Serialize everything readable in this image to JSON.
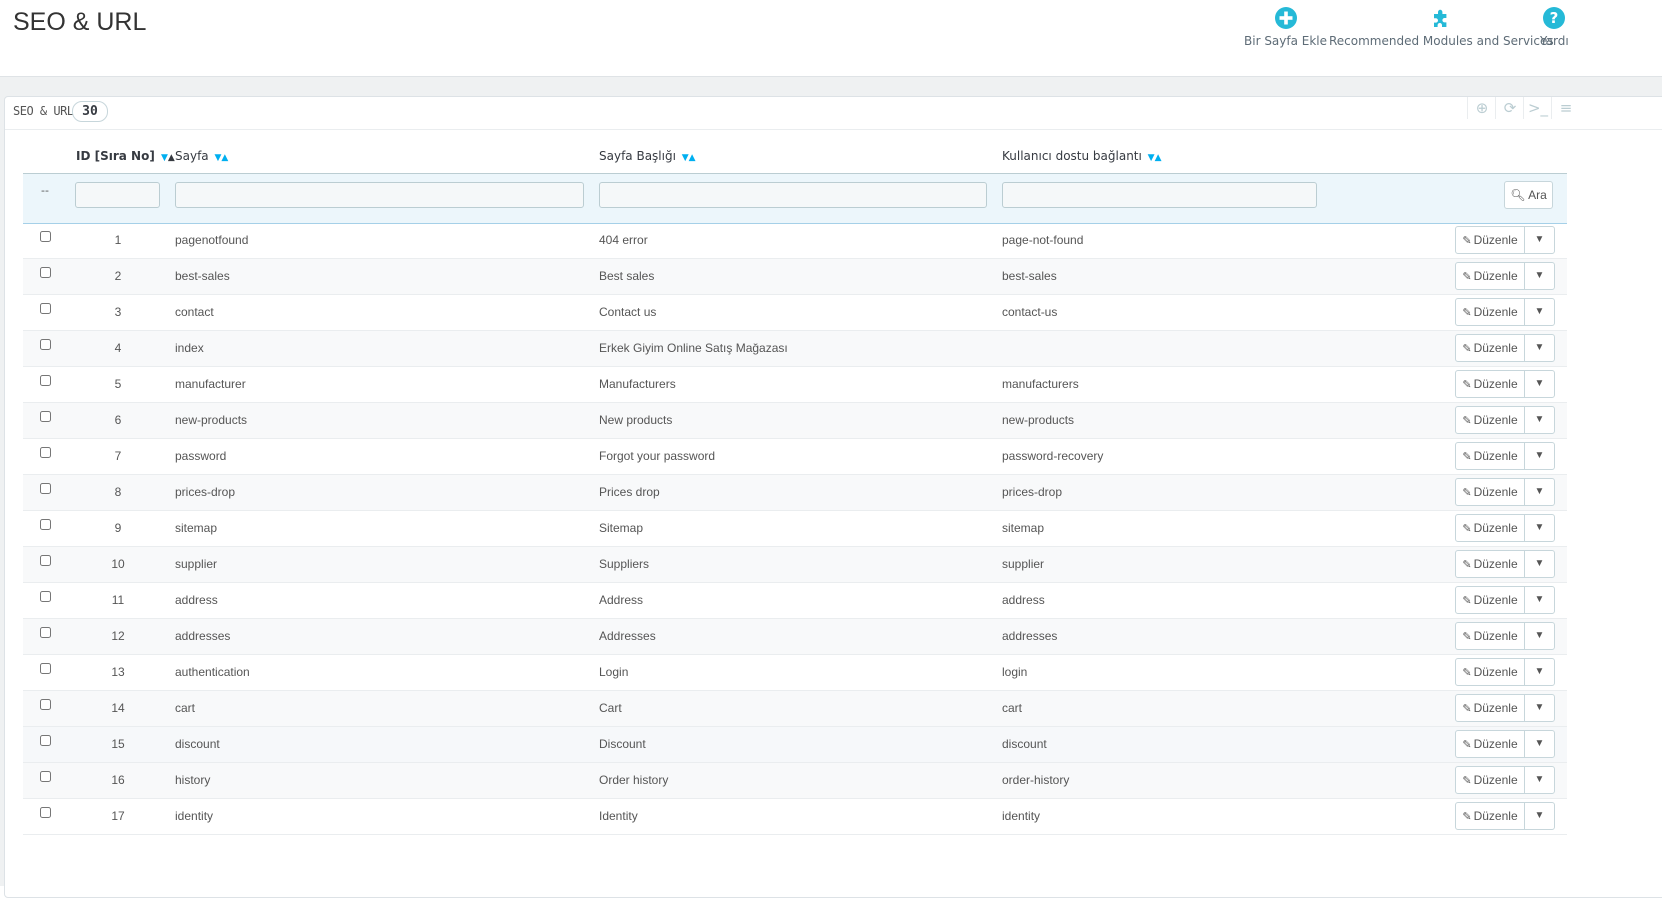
{
  "header": {
    "title": "SEO & URL",
    "toolbar": [
      {
        "label": "Bir Sayfa Ekle",
        "icon": "add-circle-icon"
      },
      {
        "label": "Recommended Modules and Services",
        "icon": "puzzle-icon"
      },
      {
        "label": "Yardı",
        "icon": "help-icon"
      }
    ]
  },
  "panel": {
    "title": "SEO & URL",
    "count": "30",
    "tools": [
      "add-icon",
      "refresh-icon",
      "terminal-icon",
      "database-icon"
    ]
  },
  "table": {
    "columns": [
      {
        "label": "ID [Sıra No]"
      },
      {
        "label": "Sayfa"
      },
      {
        "label": "Sayfa Başlığı"
      },
      {
        "label": "Kullanıcı dostu bağlantı"
      }
    ],
    "filter": {
      "bulk_placeholder": "--",
      "search_label": "Ara"
    },
    "edit_label": "Düzenle",
    "rows": [
      {
        "id": "1",
        "page": "pagenotfound",
        "title": "404 error",
        "url": "page-not-found"
      },
      {
        "id": "2",
        "page": "best-sales",
        "title": "Best sales",
        "url": "best-sales"
      },
      {
        "id": "3",
        "page": "contact",
        "title": "Contact us",
        "url": "contact-us"
      },
      {
        "id": "4",
        "page": "index",
        "title": "Erkek Giyim Online Satış Mağazası",
        "url": ""
      },
      {
        "id": "5",
        "page": "manufacturer",
        "title": "Manufacturers",
        "url": "manufacturers"
      },
      {
        "id": "6",
        "page": "new-products",
        "title": "New products",
        "url": "new-products"
      },
      {
        "id": "7",
        "page": "password",
        "title": "Forgot your password",
        "url": "password-recovery"
      },
      {
        "id": "8",
        "page": "prices-drop",
        "title": "Prices drop",
        "url": "prices-drop"
      },
      {
        "id": "9",
        "page": "sitemap",
        "title": "Sitemap",
        "url": "sitemap"
      },
      {
        "id": "10",
        "page": "supplier",
        "title": "Suppliers",
        "url": "supplier"
      },
      {
        "id": "11",
        "page": "address",
        "title": "Address",
        "url": "address"
      },
      {
        "id": "12",
        "page": "addresses",
        "title": "Addresses",
        "url": "addresses"
      },
      {
        "id": "13",
        "page": "authentication",
        "title": "Login",
        "url": "login"
      },
      {
        "id": "14",
        "page": "cart",
        "title": "Cart",
        "url": "cart"
      },
      {
        "id": "15",
        "page": "discount",
        "title": "Discount",
        "url": "discount"
      },
      {
        "id": "16",
        "page": "history",
        "title": "Order history",
        "url": "order-history"
      },
      {
        "id": "17",
        "page": "identity",
        "title": "Identity",
        "url": "identity"
      }
    ]
  },
  "colors": {
    "accent": "#25b9d7",
    "sort_arrow": "#00aff0",
    "text": "#555555"
  }
}
